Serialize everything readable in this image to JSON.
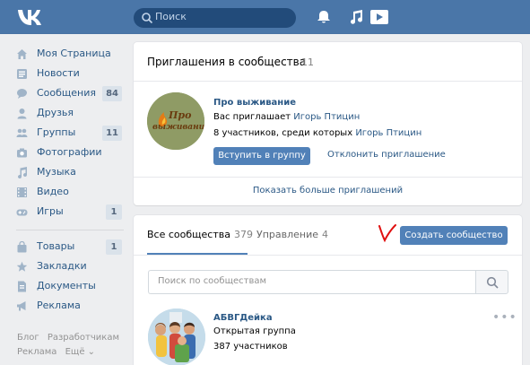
{
  "header": {
    "search_placeholder": "Поиск"
  },
  "nav": {
    "items": [
      {
        "label": "Моя Страница"
      },
      {
        "label": "Новости"
      },
      {
        "label": "Сообщения",
        "count": "84"
      },
      {
        "label": "Друзья"
      },
      {
        "label": "Группы",
        "count": "11"
      },
      {
        "label": "Фотографии"
      },
      {
        "label": "Музыка"
      },
      {
        "label": "Видео"
      },
      {
        "label": "Игры",
        "count": "1"
      },
      {
        "label": "Товары",
        "count": "1"
      },
      {
        "label": "Закладки"
      },
      {
        "label": "Документы"
      },
      {
        "label": "Реклама"
      }
    ],
    "footer": {
      "blog": "Блог",
      "developers": "Разработчикам",
      "ads": "Реклама",
      "more": "Ещё ⌄"
    }
  },
  "invites": {
    "title": "Приглашения в сообщества",
    "count": "11",
    "group": {
      "name": "Про выживание",
      "avatar_text_line1": "Про",
      "avatar_text_line2": "выживание",
      "invite_prefix": "Вас приглашает",
      "inviter": "Игорь Птицин",
      "members_prefix": "8 участников, среди которых",
      "members_friend": "Игорь Птицин"
    },
    "join_label": "Вступить в группу",
    "decline_label": "Отклонить приглашение",
    "show_more_label": "Показать больше приглашений"
  },
  "communities": {
    "tab_all_label": "Все сообщества",
    "tab_all_count": "379",
    "tab_manage_label": "Управление",
    "tab_manage_count": "4",
    "create_label": "Создать сообщество",
    "search_placeholder": "Поиск по сообществам",
    "group": {
      "name": "АБВГДейка",
      "type": "Открытая группа",
      "members": "387 участников"
    }
  },
  "colors": {
    "header": "#4a76a8",
    "accent": "#5181b8",
    "link": "#2a5885",
    "annotation": "#e01010"
  }
}
